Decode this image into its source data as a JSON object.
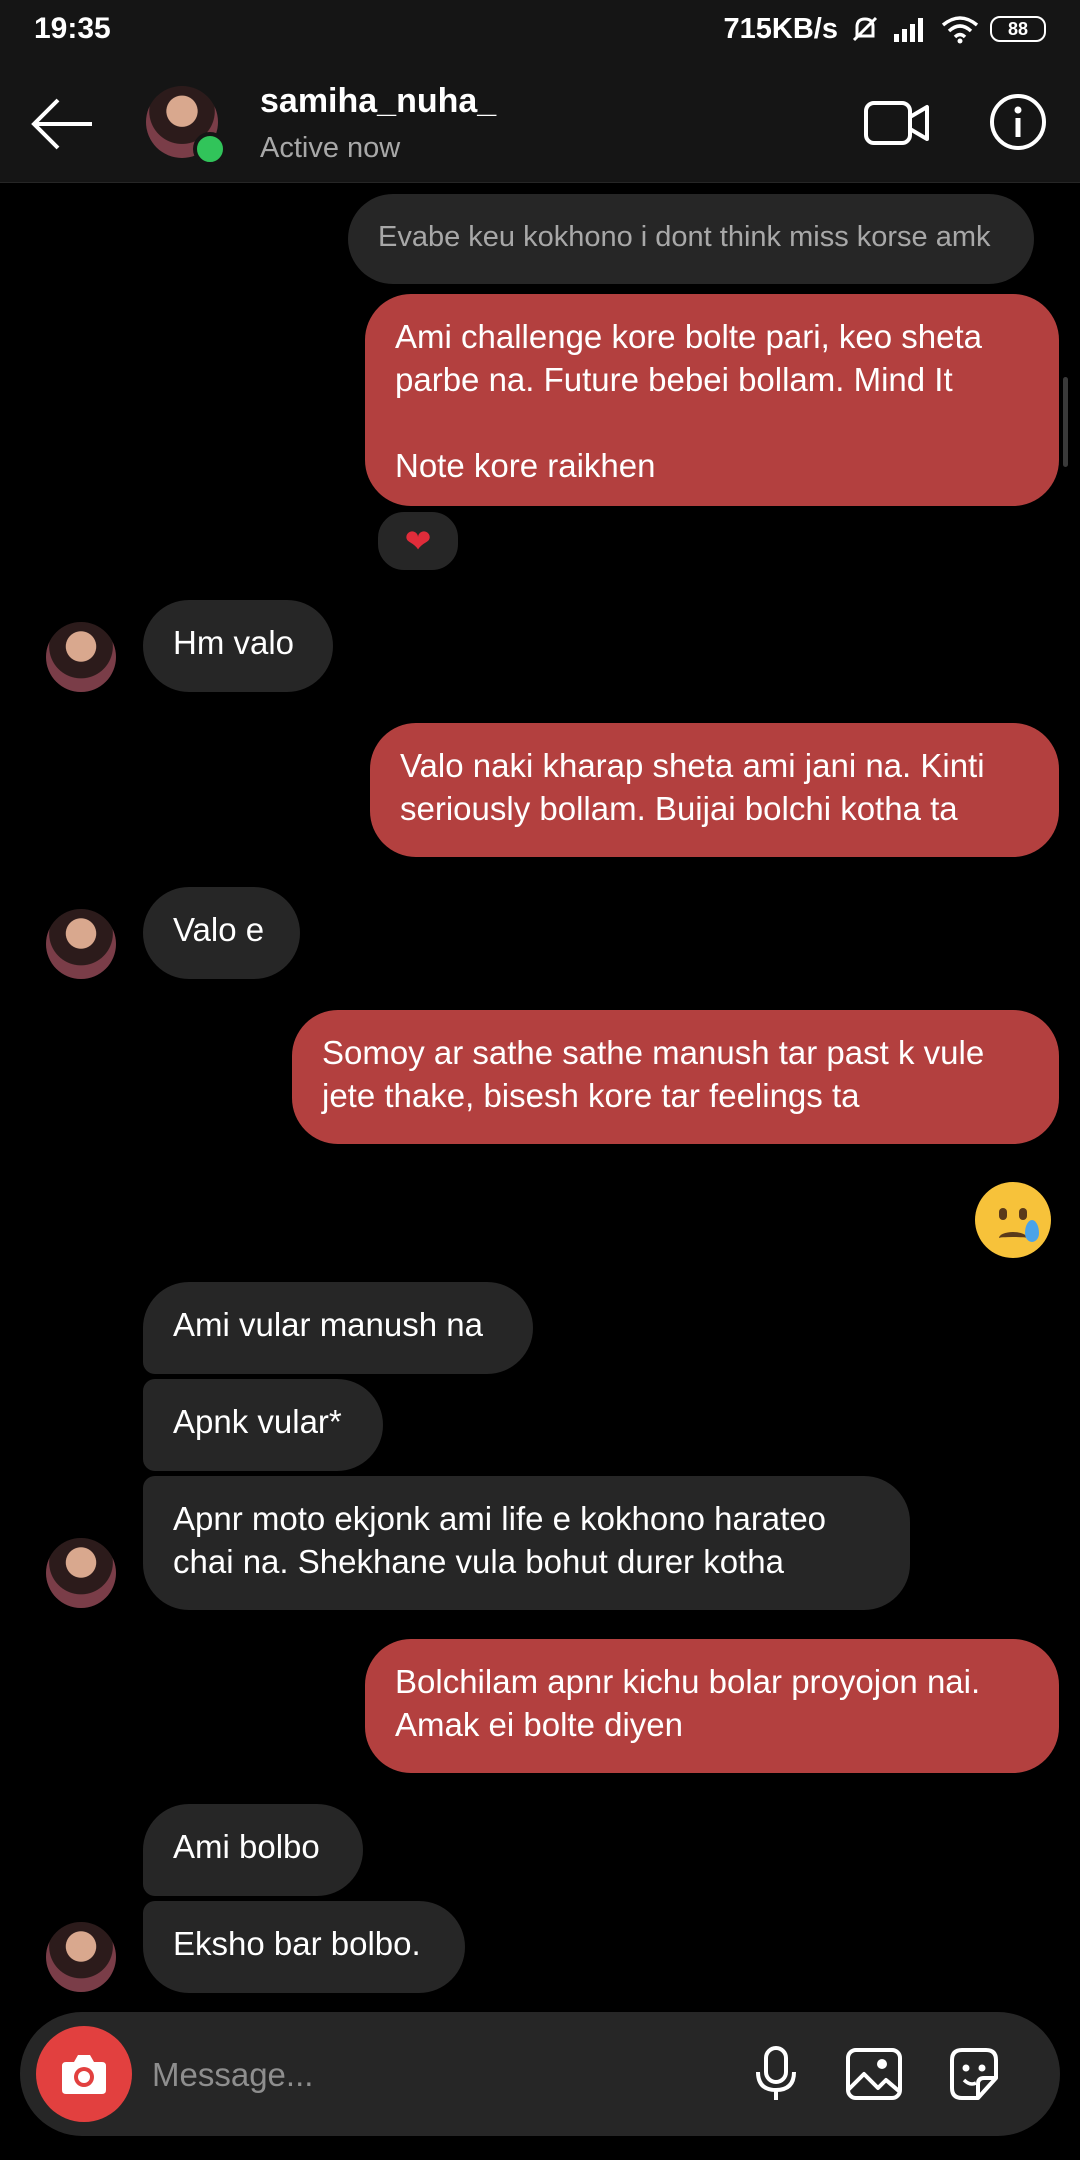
{
  "status_bar": {
    "time": "19:35",
    "speed": "715KB/s",
    "battery": "88"
  },
  "header": {
    "username": "samiha_nuha_",
    "status": "Active now"
  },
  "messages": {
    "m0": "Evabe keu kokhono i dont think miss korse amk",
    "m1": "Ami challenge kore bolte pari, keo sheta\nparbe na. Future bebei bollam. Mind It\n\nNote kore raikhen",
    "m1_reaction": "❤",
    "m2": "Hm valo",
    "m3": "Valo naki kharap sheta ami jani na. Kinti\nseriously bollam. Buijai bolchi kotha ta",
    "m4": "Valo e",
    "m5": "Somoy ar sathe sathe manush tar past k vule\njete thake, bisesh kore tar feelings ta",
    "m6_emoji": "crying-face",
    "m7": "Ami vular manush na",
    "m8": "Apnk vular*",
    "m9": "Apnr moto ekjonk ami life e kokhono harateo\nchai na. Shekhane vula bohut durer kotha",
    "m10": "Bolchilam apnr kichu bolar proyojon nai.\nAmak ei bolte diyen",
    "m11": "Ami bolbo",
    "m12": "Eksho bar bolbo."
  },
  "composer": {
    "placeholder": "Message..."
  },
  "colors": {
    "outgoing_bubble": "#b3403f",
    "incoming_bubble": "#262626",
    "online": "#31c45a",
    "camera_button": "#e2403f"
  }
}
